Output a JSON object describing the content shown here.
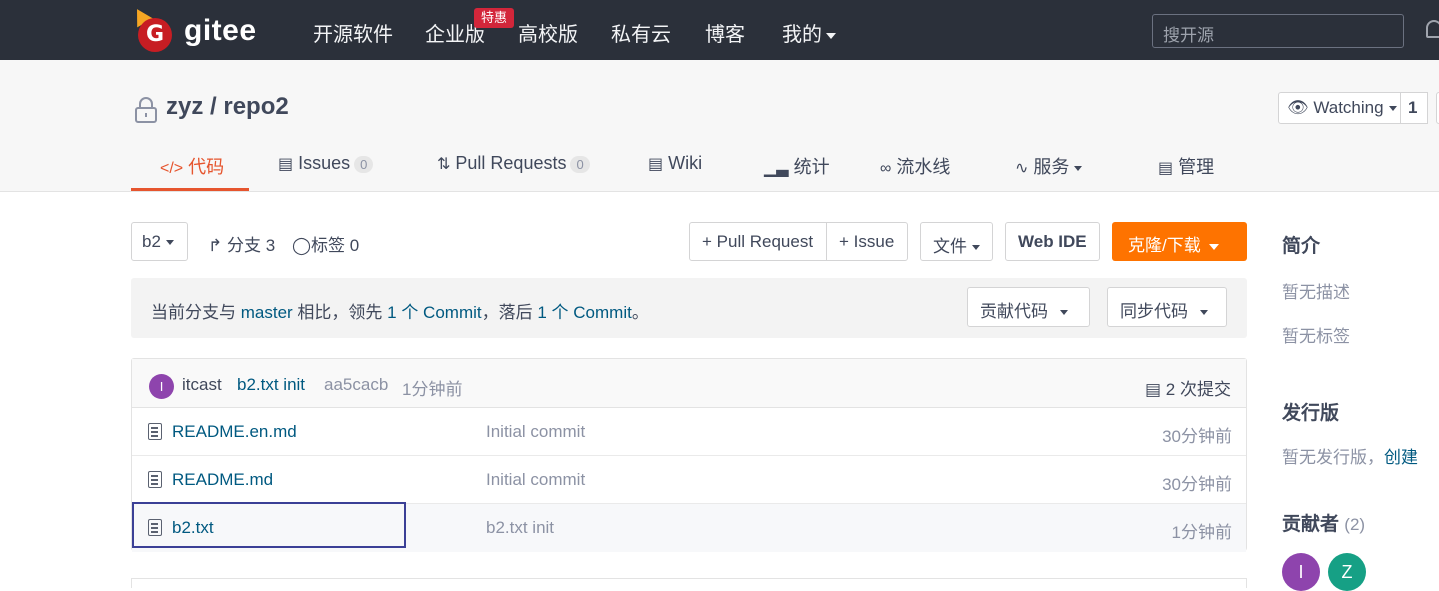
{
  "topnav": {
    "logo_text": "gitee",
    "items": [
      "开源软件",
      "企业版",
      "高校版",
      "私有云",
      "博客",
      "我的"
    ],
    "badge": "特惠",
    "search_placeholder": "搜开源",
    "colors": {
      "bg": "#2b303a",
      "brand": "#c71d23"
    }
  },
  "repo": {
    "title": "zyz / repo2",
    "watch_label": "Watching",
    "watch_count": "1"
  },
  "tabs": [
    {
      "label": "代码",
      "icon": "code-icon"
    },
    {
      "label": "Issues",
      "count": "0",
      "icon": "issues-icon"
    },
    {
      "label": "Pull Requests",
      "count": "0",
      "icon": "pull-request-icon"
    },
    {
      "label": "Wiki",
      "icon": "wiki-icon"
    },
    {
      "label": "统计",
      "icon": "stats-icon"
    },
    {
      "label": "流水线",
      "icon": "pipeline-icon"
    },
    {
      "label": "服务",
      "icon": "service-icon"
    },
    {
      "label": "管理",
      "icon": "manage-icon"
    }
  ],
  "toolbar": {
    "branch": "b2",
    "branches_label": "分支 3",
    "tags_label": "标签 0",
    "pull_request": "+ Pull Request",
    "issue": "+ Issue",
    "file": "文件",
    "web_ide": "Web IDE",
    "clone": "克隆/下载"
  },
  "notice": {
    "prefix": "当前分支与 ",
    "branch": "master",
    "middle1": " 相比，领先 ",
    "ahead": "1 个 Commit",
    "middle2": "，落后 ",
    "behind": "1 个 Commit",
    "suffix": "。",
    "contribute": "贡献代码",
    "sync": "同步代码"
  },
  "commit": {
    "avatar_letter": "I",
    "author": "itcast",
    "message": "b2.txt init",
    "hash": "aa5cacb",
    "time": "1分钟前",
    "total": "2 次提交"
  },
  "files": [
    {
      "name": "README.en.md",
      "message": "Initial commit",
      "time": "30分钟前"
    },
    {
      "name": "README.md",
      "message": "Initial commit",
      "time": "30分钟前"
    },
    {
      "name": "b2.txt",
      "message": "b2.txt init",
      "time": "1分钟前"
    }
  ],
  "sidebar": {
    "intro_title": "简介",
    "no_desc": "暂无描述",
    "no_tags": "暂无标签",
    "release_title": "发行版",
    "no_release": "暂无发行版，",
    "create": "创建",
    "contributors_title": "贡献者",
    "contributors_count": "(2)",
    "contributors": [
      {
        "letter": "I",
        "color": "#8e44ad"
      },
      {
        "letter": "Z",
        "color": "#16a085"
      }
    ]
  },
  "accent_color": "#e6552e"
}
